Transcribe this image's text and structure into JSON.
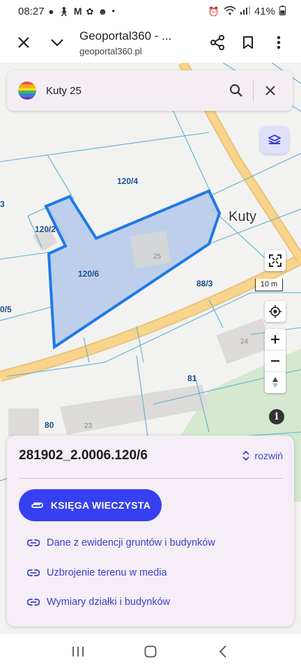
{
  "status": {
    "time": "08:27",
    "battery": "41%"
  },
  "browser": {
    "page_title": "Geoportal360 - ...",
    "url": "geoportal360.pl"
  },
  "search": {
    "value": "Kuty 25"
  },
  "map": {
    "labels": {
      "parcel_120_4": "120/4",
      "parcel_120_2": "120/2",
      "parcel_120_6": "120/6",
      "parcel_88_3": "88/3",
      "parcel_0_5": "0/5",
      "parcel_81": "81",
      "parcel_80": "80",
      "edge_3": "3",
      "place_kuty": "Kuty",
      "building_25": "25",
      "building_24": "24",
      "building_23": "23"
    },
    "scale_label": "10 m",
    "colors": {
      "selection_fill": "#b4c9ea",
      "selection_stroke": "#1f7ae6",
      "road": "#f8d48c",
      "parcel_lines": "#5fb3d1",
      "building": "#dcdbd9",
      "park": "#d5e8d0"
    }
  },
  "sheet": {
    "parcel_id": "281902_2.0006.120/6",
    "expand_label": "rozwiń",
    "primary_button": "KSIĘGA WIECZYSTA",
    "links": [
      "Dane z ewidencji gruntów i budynków",
      "Uzbrojenie terenu w media",
      "Wymiary działki i budynków"
    ]
  },
  "icons": {
    "close": "close-icon",
    "chevron": "chevron-down-icon",
    "share": "share-icon",
    "bookmark": "bookmark-icon",
    "more": "more-vert-icon",
    "search": "search-icon",
    "layers": "layers-icon",
    "fullscreen": "fullscreen-icon",
    "locate": "locate-icon",
    "compass": "compass-icon",
    "info": "info-icon",
    "link": "link-icon"
  }
}
